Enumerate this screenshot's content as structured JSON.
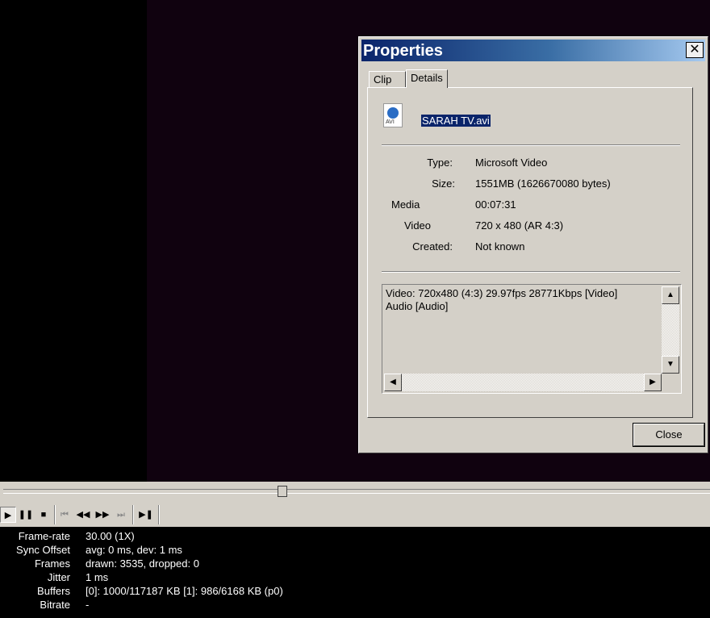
{
  "dialog": {
    "title": "Properties",
    "close_glyph": "✕",
    "tabs": [
      {
        "label": "Clip"
      },
      {
        "label": "Details"
      }
    ],
    "file_icon_label": "AVI",
    "file_icon": "avi-file-icon",
    "filename": "SARAH TV.avi",
    "details": [
      {
        "label": "Type:",
        "value": "Microsoft Video"
      },
      {
        "label": "Size:",
        "value": "1551MB (1626670080 bytes)"
      },
      {
        "label": "Media",
        "value": "00:07:31"
      },
      {
        "label": "Video",
        "value": "720 x 480 (AR 4:3)"
      },
      {
        "label": "Created:",
        "value": "Not known"
      }
    ],
    "streams": [
      "Video: 720x480 (4:3) 29.97fps 28771Kbps [Video]",
      "Audio [Audio]"
    ],
    "close_button": "Close"
  },
  "seek": {
    "position_fraction": 0.395
  },
  "toolbar": {
    "buttons": [
      {
        "name": "play-icon",
        "glyph": "▶",
        "active": true
      },
      {
        "name": "pause-icon",
        "glyph": "❚❚"
      },
      {
        "name": "stop-icon",
        "glyph": "■"
      },
      {
        "name": "skip-back-icon",
        "glyph": "⏮",
        "disabled": true
      },
      {
        "name": "rewind-icon",
        "glyph": "◀◀"
      },
      {
        "name": "fast-forward-icon",
        "glyph": "▶▶"
      },
      {
        "name": "skip-forward-icon",
        "glyph": "⏭",
        "disabled": true
      },
      {
        "name": "frame-step-icon",
        "glyph": "▶❚"
      }
    ]
  },
  "stats": [
    {
      "label": "Frame-rate",
      "value": "30.00 (1X)"
    },
    {
      "label": "Sync Offset",
      "value": "avg: 0 ms, dev: 1 ms"
    },
    {
      "label": "Frames",
      "value": "drawn: 3535, dropped: 0"
    },
    {
      "label": "Jitter",
      "value": "1 ms"
    },
    {
      "label": "Buffers",
      "value": "[0]: 1000/117187 KB [1]: 986/6168 KB (p0)"
    },
    {
      "label": "Bitrate",
      "value": "-"
    }
  ]
}
